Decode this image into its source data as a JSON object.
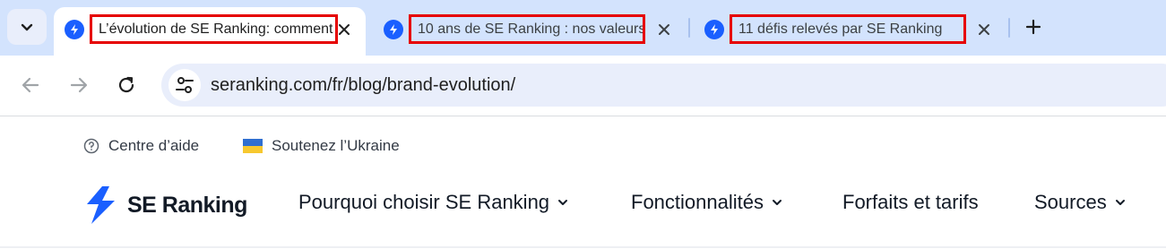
{
  "browser": {
    "tabs": [
      {
        "title": "L’évolution de SE Ranking: comment",
        "active": true
      },
      {
        "title": "10 ans de SE Ranking : nos valeurs",
        "active": false
      },
      {
        "title": "11 défis relevés par SE Ranking",
        "active": false
      }
    ],
    "url": "seranking.com/fr/blog/brand-evolution/",
    "colors": {
      "tabstrip": "#d3e3fd",
      "highlight": "#e60000",
      "favicon": "#1a5fff"
    }
  },
  "page": {
    "topbar": {
      "help_label": "Centre d’aide",
      "ukraine_label": "Soutenez l’Ukraine"
    },
    "brand": {
      "name": "SE Ranking",
      "color": "#1a5fff"
    },
    "nav": [
      {
        "label": "Pourquoi choisir SE Ranking",
        "has_dropdown": true
      },
      {
        "label": "Fonctionnalités",
        "has_dropdown": true
      },
      {
        "label": "Forfaits et tarifs",
        "has_dropdown": false
      },
      {
        "label": "Sources",
        "has_dropdown": true
      }
    ]
  }
}
